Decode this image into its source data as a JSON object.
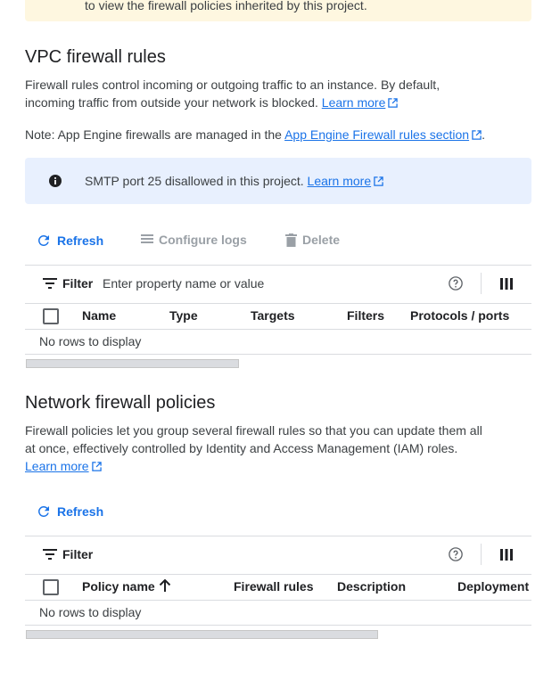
{
  "banner": {
    "text": "to view the firewall policies inherited by this project."
  },
  "vpc": {
    "title": "VPC firewall rules",
    "desc_line1": "Firewall rules control incoming or outgoing traffic to an instance. By default,",
    "desc_line2": "incoming traffic from outside your network is blocked.",
    "learn_more": "Learn more",
    "note_prefix": "Note: App Engine firewalls are managed in the",
    "note_link": "App Engine Firewall rules section",
    "note_suffix": ".",
    "info_text": "SMTP port 25 disallowed in this project.",
    "info_link": "Learn more",
    "toolbar": {
      "refresh": "Refresh",
      "configure_logs": "Configure logs",
      "delete": "Delete"
    },
    "filter": {
      "label": "Filter",
      "placeholder": "Enter property name or value"
    },
    "columns": [
      "Name",
      "Type",
      "Targets",
      "Filters",
      "Protocols / ports"
    ],
    "empty": "No rows to display"
  },
  "network": {
    "title": "Network firewall policies",
    "desc_line1": "Firewall policies let you group several firewall rules so that you can update them all",
    "desc_line2": "at once, effectively controlled by Identity and Access Management (IAM) roles.",
    "learn_more": "Learn more",
    "toolbar": {
      "refresh": "Refresh"
    },
    "filter": {
      "label": "Filter"
    },
    "columns": [
      "Policy name",
      "Firewall rules",
      "Description",
      "Deployment"
    ],
    "empty": "No rows to display"
  },
  "colors": {
    "accent": "#1a73e8",
    "info_bg": "#e8f0fe",
    "warning_bg": "#fef7e0",
    "disabled": "#9aa0a6"
  }
}
